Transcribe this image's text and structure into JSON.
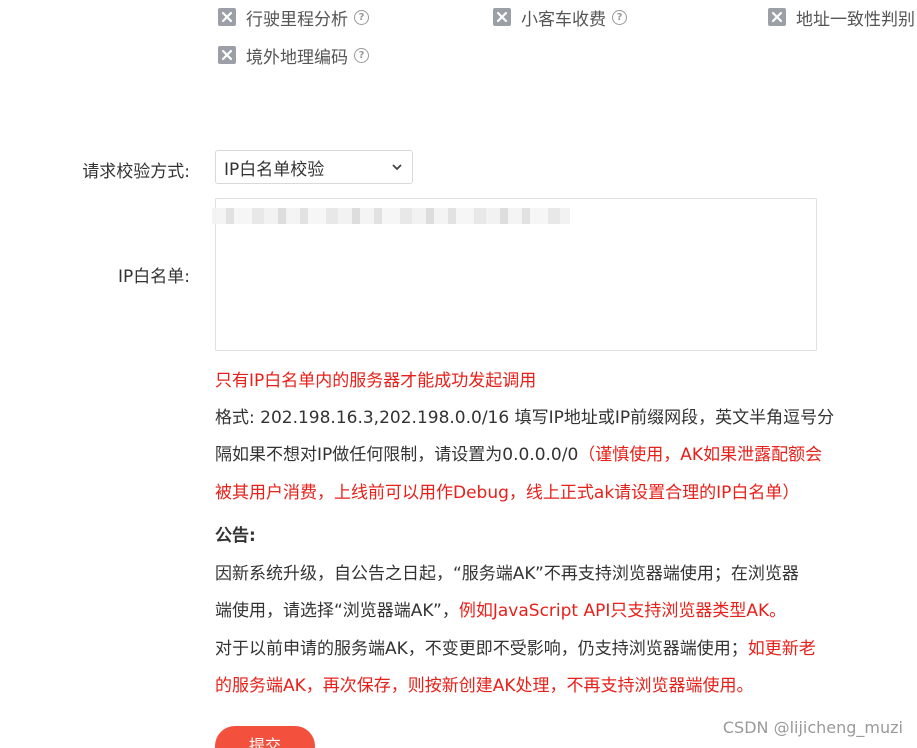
{
  "services": [
    {
      "label": "行驶里程分析",
      "checked": true
    },
    {
      "label": "小客车收费",
      "checked": true
    },
    {
      "label": "地址一致性判别",
      "checked": true
    },
    {
      "label": "境外地理编码",
      "checked": true
    }
  ],
  "form": {
    "verify_label": "请求校验方式:",
    "verify_value": "IP白名单校验",
    "ip_label": "IP白名单:"
  },
  "notes": {
    "warning": "只有IP白名单内的服务器才能成功发起调用",
    "format_line1": "格式: 202.198.16.3,202.198.0.0/16 填写IP地址或IP前缀网段，英文半角逗号分",
    "format_line2_black": "隔如果不想对IP做任何限制，请设置为0.0.0.0/0",
    "format_line2_red": "（谨慎使用，AK如果泄露配额会",
    "format_line3_red": "被其用户消费，上线前可以用作Debug，线上正式ak请设置合理的IP白名单）"
  },
  "announcement": {
    "title": "公告:",
    "line1": "因新系统升级，自公告之日起，“服务端AK”不再支持浏览器端使用；在浏览器",
    "line2_black": "端使用，请选择“浏览器端AK”，",
    "line2_red": "例如JavaScript API只支持浏览器类型AK。",
    "line3_black": "对于以前申请的服务端AK，不变更即不受影响，仍支持浏览器端使用；",
    "line3_red": "如更新老",
    "line4_red": "的服务端AK，再次保存，则按新创建AK处理，不再支持浏览器端使用。"
  },
  "submit_label": "提交",
  "watermark": "CSDN @lijicheng_muzi",
  "colors": {
    "accent_red": "#e8201a",
    "button": "#f4503e",
    "checkbox": "#9aa0a6"
  }
}
